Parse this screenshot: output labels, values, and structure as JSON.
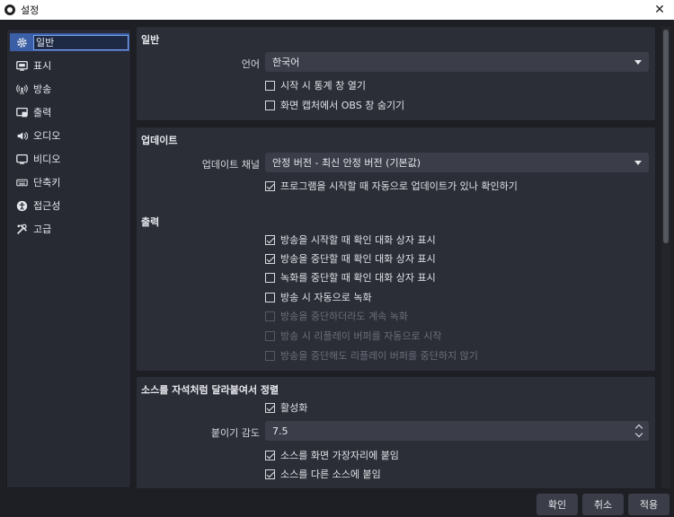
{
  "window": {
    "title": "설정"
  },
  "sidebar": {
    "items": [
      {
        "label": "일반",
        "icon": "gear-icon"
      },
      {
        "label": "표시",
        "icon": "display-icon"
      },
      {
        "label": "방송",
        "icon": "broadcast-icon"
      },
      {
        "label": "출력",
        "icon": "output-icon"
      },
      {
        "label": "오디오",
        "icon": "speaker-icon"
      },
      {
        "label": "비디오",
        "icon": "monitor-icon"
      },
      {
        "label": "단축키",
        "icon": "keyboard-icon"
      },
      {
        "label": "접근성",
        "icon": "accessibility-icon"
      },
      {
        "label": "고급",
        "icon": "tools-icon"
      }
    ]
  },
  "general": {
    "title": "일반",
    "language_label": "언어",
    "language_value": "한국어",
    "checks": [
      {
        "label": "시작 시 통계 창 열기",
        "checked": false
      },
      {
        "label": "화면 캡처에서 OBS 창 숨기기",
        "checked": false
      }
    ]
  },
  "update": {
    "title": "업데이트",
    "channel_label": "업데이트 채널",
    "channel_value": "안정 버전 - 최신 안정 버전 (기본값)",
    "checks": [
      {
        "label": "프로그램을 시작할 때 자동으로 업데이트가 있나 확인하기",
        "checked": true
      }
    ]
  },
  "output": {
    "title": "출력",
    "checks": [
      {
        "label": "방송을 시작할 때 확인 대화 상자 표시",
        "checked": true,
        "disabled": false
      },
      {
        "label": "방송을 중단할 때 확인 대화 상자 표시",
        "checked": true,
        "disabled": false
      },
      {
        "label": "녹화를 중단할 때 확인 대화 상자 표시",
        "checked": false,
        "disabled": false
      },
      {
        "label": "방송 시 자동으로 녹화",
        "checked": false,
        "disabled": false
      },
      {
        "label": "방송을 중단하더라도 계속 녹화",
        "checked": false,
        "disabled": true
      },
      {
        "label": "방송 시 리플레이 버퍼를 자동으로 시작",
        "checked": false,
        "disabled": true
      },
      {
        "label": "방송을 중단해도 리플레이 버퍼를 중단하지 않기",
        "checked": false,
        "disabled": true
      }
    ]
  },
  "snapping": {
    "title": "소스를 자석처럼 달라붙여서 정렬",
    "enable_label": "활성화",
    "enable_checked": true,
    "sensitivity_label": "붙이기 감도",
    "sensitivity_value": "7.5",
    "checks": [
      {
        "label": "소스를 화면 가장자리에 붙임",
        "checked": true
      },
      {
        "label": "소스를 다른 소스에 붙임",
        "checked": true
      }
    ]
  },
  "buttons": {
    "ok": "확인",
    "cancel": "취소",
    "apply": "적용"
  }
}
